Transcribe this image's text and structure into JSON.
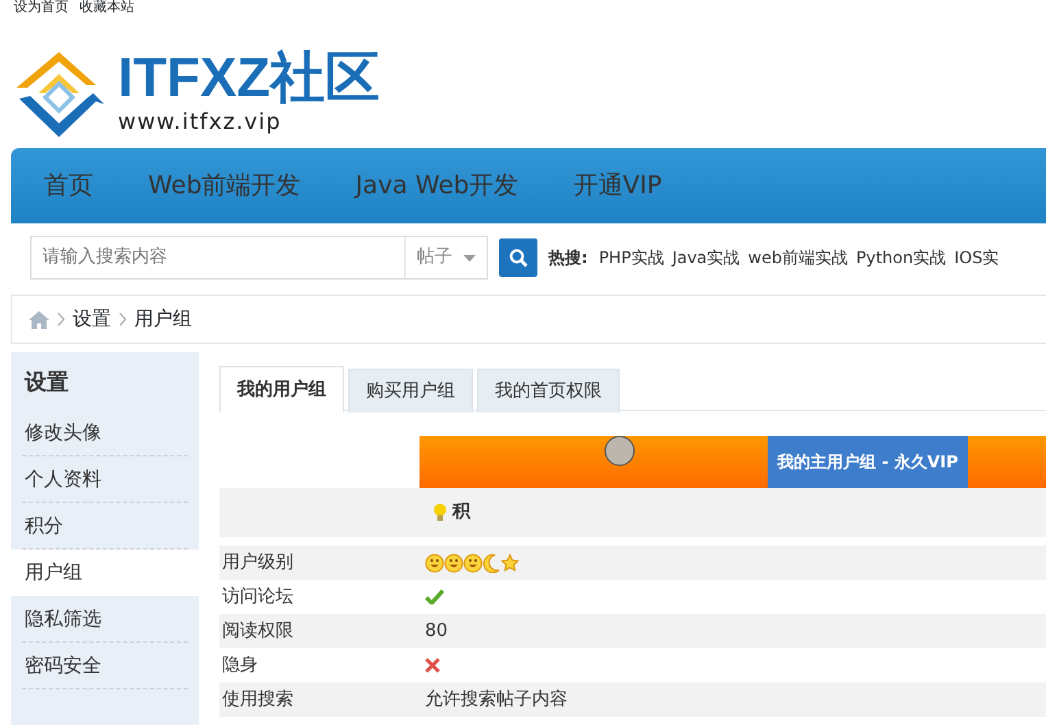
{
  "top_links": [
    "设为首页",
    "收藏本站"
  ],
  "logo": {
    "title": "ITFXZ社区",
    "url": "www.itfxz.vip"
  },
  "nav": [
    {
      "label": "首页"
    },
    {
      "label": "Web前端开发"
    },
    {
      "label": "Java Web开发"
    },
    {
      "label": "开通VIP"
    }
  ],
  "search": {
    "placeholder": "请输入搜索内容",
    "scope": "帖子",
    "hot_label": "热搜:",
    "hot": [
      "PHP实战",
      "Java实战",
      "web前端实战",
      "Python实战",
      "IOS实"
    ]
  },
  "breadcrumb": [
    "设置",
    "用户组"
  ],
  "sidebar": {
    "title": "设置",
    "items": [
      {
        "label": "修改头像",
        "selected": false
      },
      {
        "label": "个人资料",
        "selected": false
      },
      {
        "label": "积分",
        "selected": false
      },
      {
        "label": "用户组",
        "selected": true
      },
      {
        "label": "隐私筛选",
        "selected": false
      },
      {
        "label": "密码安全",
        "selected": false
      }
    ]
  },
  "tabs": [
    {
      "label": "我的用户组",
      "selected": true
    },
    {
      "label": "购买用户组",
      "selected": false
    },
    {
      "label": "我的首页权限",
      "selected": false
    }
  ],
  "group_bar": {
    "label": "我的主用户组 - 永久VIP"
  },
  "points_label": "积",
  "rows": [
    {
      "label": "用户级别",
      "kind": "level"
    },
    {
      "label": "访问论坛",
      "kind": "yes"
    },
    {
      "label": "阅读权限",
      "kind": "text",
      "value": "80"
    },
    {
      "label": "隐身",
      "kind": "no"
    },
    {
      "label": "使用搜索",
      "kind": "text",
      "value": "允许搜索帖子内容"
    }
  ]
}
